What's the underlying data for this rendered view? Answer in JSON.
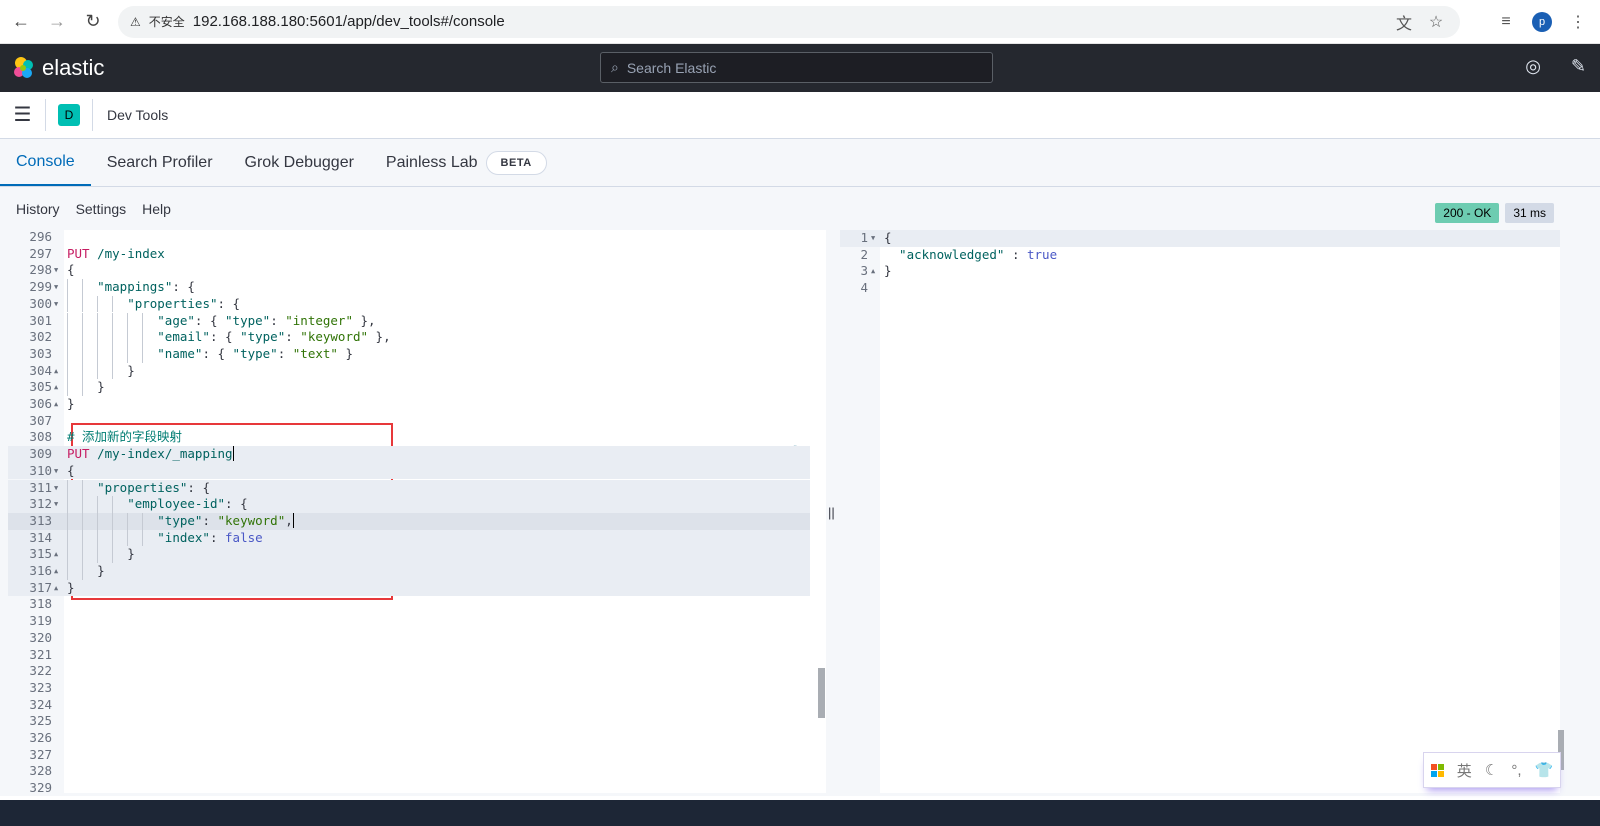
{
  "browser": {
    "url": "192.168.188.180:5601/app/dev_tools#/console",
    "insecure_label": "不安全",
    "profile_initial": "p"
  },
  "header": {
    "brand": "elastic",
    "search_placeholder": "Search Elastic"
  },
  "breadcrumb": {
    "space_initial": "D",
    "title": "Dev Tools"
  },
  "tabs": [
    {
      "label": "Console",
      "active": true
    },
    {
      "label": "Search Profiler"
    },
    {
      "label": "Grok Debugger"
    },
    {
      "label": "Painless Lab",
      "badge": "BETA"
    }
  ],
  "toolbar": {
    "history": "History",
    "settings": "Settings",
    "help": "Help",
    "status": "200 - OK",
    "duration": "31 ms"
  },
  "colors": {
    "accent": "#006bb8",
    "status_ok": "#6dccb1",
    "selection_box": "#e7383a"
  },
  "editor": {
    "lines": [
      {
        "n": "296",
        "t": []
      },
      {
        "n": "297",
        "t": [
          [
            "method",
            "PUT"
          ],
          [
            "url",
            " /my-index"
          ]
        ]
      },
      {
        "n": "298",
        "f": "open",
        "t": [
          [
            "punc",
            "{"
          ]
        ]
      },
      {
        "n": "299",
        "f": "open",
        "g": 2,
        "t": [
          [
            "key",
            "\"mappings\""
          ],
          [
            "punc",
            ": {"
          ]
        ]
      },
      {
        "n": "300",
        "f": "open",
        "g": 4,
        "t": [
          [
            "key",
            "\"properties\""
          ],
          [
            "punc",
            ": {"
          ]
        ]
      },
      {
        "n": "301",
        "g": 6,
        "t": [
          [
            "key",
            "\"age\""
          ],
          [
            "punc",
            ": { "
          ],
          [
            "key",
            "\"type\""
          ],
          [
            "punc",
            ": "
          ],
          [
            "str",
            "\"integer\""
          ],
          [
            "punc",
            " },"
          ]
        ]
      },
      {
        "n": "302",
        "g": 6,
        "t": [
          [
            "key",
            "\"email\""
          ],
          [
            "punc",
            ": { "
          ],
          [
            "key",
            "\"type\""
          ],
          [
            "punc",
            ": "
          ],
          [
            "str",
            "\"keyword\""
          ],
          [
            "punc",
            " },"
          ]
        ]
      },
      {
        "n": "303",
        "g": 6,
        "t": [
          [
            "key",
            "\"name\""
          ],
          [
            "punc",
            ": { "
          ],
          [
            "key",
            "\"type\""
          ],
          [
            "punc",
            ": "
          ],
          [
            "str",
            "\"text\""
          ],
          [
            "punc",
            " }"
          ]
        ]
      },
      {
        "n": "304",
        "f": "close",
        "g": 4,
        "t": [
          [
            "punc",
            "}"
          ]
        ]
      },
      {
        "n": "305",
        "f": "close",
        "g": 2,
        "t": [
          [
            "punc",
            "}"
          ]
        ]
      },
      {
        "n": "306",
        "f": "close",
        "t": [
          [
            "punc",
            "}"
          ]
        ]
      },
      {
        "n": "307",
        "t": []
      },
      {
        "n": "308",
        "t": [
          [
            "comment",
            "# 添加新的字段映射"
          ]
        ]
      },
      {
        "n": "309",
        "b": 1,
        "t": [
          [
            "method",
            "PUT"
          ],
          [
            "url",
            " /my-index/_mapping"
          ]
        ]
      },
      {
        "n": "310",
        "b": 1,
        "f": "open",
        "t": [
          [
            "punc",
            "{"
          ]
        ]
      },
      {
        "n": "311",
        "b": 1,
        "f": "open",
        "g": 2,
        "t": [
          [
            "key",
            "\"properties\""
          ],
          [
            "punc",
            ": {"
          ]
        ]
      },
      {
        "n": "312",
        "b": 1,
        "f": "open",
        "g": 4,
        "t": [
          [
            "key",
            "\"employee-id\""
          ],
          [
            "punc",
            ": {"
          ]
        ]
      },
      {
        "n": "313",
        "b": 1,
        "active": 1,
        "g": 6,
        "t": [
          [
            "key",
            "\"type\""
          ],
          [
            "punc",
            ": "
          ],
          [
            "str",
            "\"keyword\""
          ],
          [
            "punc",
            ","
          ]
        ]
      },
      {
        "n": "314",
        "b": 1,
        "g": 6,
        "t": [
          [
            "key",
            "\"index\""
          ],
          [
            "punc",
            ": "
          ],
          [
            "bool",
            "false"
          ]
        ]
      },
      {
        "n": "315",
        "b": 1,
        "f": "close",
        "g": 4,
        "t": [
          [
            "punc",
            "}"
          ]
        ]
      },
      {
        "n": "316",
        "b": 1,
        "f": "close",
        "g": 2,
        "t": [
          [
            "punc",
            "}"
          ]
        ]
      },
      {
        "n": "317",
        "b": 1,
        "f": "close",
        "t": [
          [
            "punc",
            "}"
          ]
        ]
      },
      {
        "n": "318",
        "t": []
      },
      {
        "n": "319",
        "t": []
      },
      {
        "n": "320",
        "t": []
      },
      {
        "n": "321",
        "t": []
      },
      {
        "n": "322",
        "t": []
      },
      {
        "n": "323",
        "t": []
      },
      {
        "n": "324",
        "t": []
      },
      {
        "n": "325",
        "t": []
      },
      {
        "n": "326",
        "t": []
      },
      {
        "n": "327",
        "t": []
      },
      {
        "n": "328",
        "t": []
      },
      {
        "n": "329",
        "t": []
      }
    ]
  },
  "output": {
    "lines": [
      {
        "n": "1",
        "f": "open",
        "t": [
          [
            "punc",
            "{"
          ]
        ]
      },
      {
        "n": "2",
        "t": [
          [
            "key",
            "  \"acknowledged\""
          ],
          [
            "punc",
            " : "
          ],
          [
            "bool",
            "true"
          ]
        ]
      },
      {
        "n": "3",
        "f": "close",
        "t": [
          [
            "punc",
            "}"
          ]
        ]
      },
      {
        "n": "4",
        "t": []
      }
    ]
  },
  "ime": {
    "mode": "英"
  }
}
